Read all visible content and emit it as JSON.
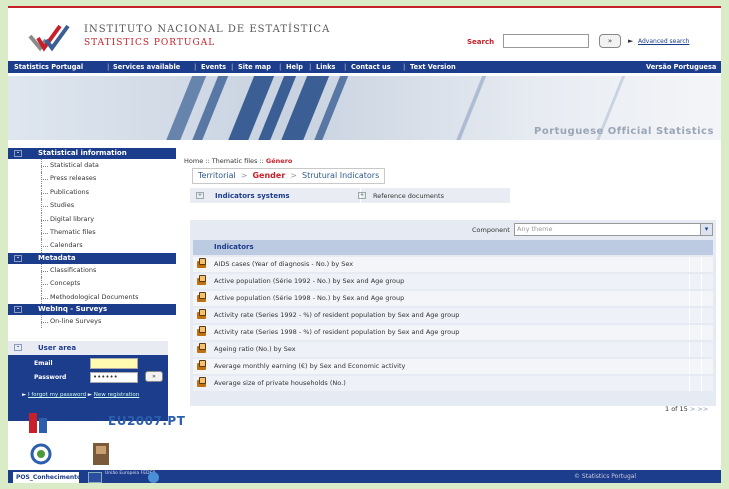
{
  "header": {
    "brand_line1": "INSTITUTO NACIONAL DE ESTATÍSTICA",
    "brand_line2": "STATISTICS PORTUGAL",
    "search_label": "Search",
    "search_go": "»",
    "advanced_search": "Advanced search"
  },
  "nav": {
    "items": [
      "Statistics Portugal",
      "Services available",
      "Events",
      "Site map",
      "Help",
      "Links",
      "Contact us",
      "Text Version"
    ],
    "lang": "Versão Portuguesa"
  },
  "banner": {
    "caption": "Portuguese Official Statistics"
  },
  "sidebar": {
    "sections": [
      {
        "title": "Statistical information",
        "items": [
          "Statistical data",
          "Press releases",
          "Publications",
          "Studies",
          "Digital library",
          "Thematic files",
          "Calendars"
        ]
      },
      {
        "title": "Metadata",
        "items": [
          "Classifications",
          "Concepts",
          "Methodological Documents"
        ]
      },
      {
        "title": "WebInq - Surveys",
        "items": [
          "On-line Surveys"
        ]
      }
    ],
    "user_area": {
      "title": "User area",
      "email_label": "Email",
      "password_label": "Password",
      "password_value": "••••••",
      "go": "»",
      "forgot": "I forgot my password",
      "new_reg": "New registration"
    },
    "eu_logo": "EU2007.PT"
  },
  "breadcrumb": {
    "home": "Home :: Thematic files ::",
    "current": "Género"
  },
  "tabs": [
    "Territorial",
    "Gender",
    "Strutural Indicators"
  ],
  "subtabs": {
    "left": "Indicators systems",
    "right": "Reference documents"
  },
  "panel": {
    "component_label": "Component",
    "component_value": "Any theme",
    "indicators_header": "Indicators",
    "rows": [
      "AIDS cases (Year of diagnosis - No.) by Sex",
      "Active population (Série 1992 - No.) by Sex and Age group",
      "Active population (Série 1998 - No.) by Sex and Age group",
      "Activity rate (Series 1992 - %) of resident population by Sex and Age group",
      "Activity rate (Series 1998 - %) of resident population by Sex and Age group",
      "Ageing ratio (No.) by Sex",
      "Average monthly earning (€) by Sex and Economic activity",
      "Average size of private households (No.)"
    ],
    "pager": "1 of 15",
    "pager_next": "> >>"
  },
  "footer": {
    "pos": "POS_Conhecimento",
    "ue_text": "União Europeia FEDER",
    "copyright": "© Statistics Portugal"
  }
}
